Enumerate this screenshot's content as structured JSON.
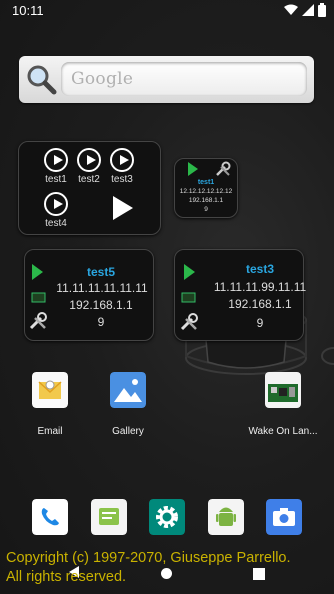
{
  "status_bar": {
    "time": "10:11"
  },
  "search": {
    "label": "Google"
  },
  "play_widget": {
    "items": [
      {
        "label": "test1"
      },
      {
        "label": "test2"
      },
      {
        "label": "test3"
      },
      {
        "label": "test4"
      }
    ]
  },
  "small_host_widget": {
    "title": "test1",
    "lines": [
      "12.12.12.12.12.12",
      "192.168.1.1",
      "9"
    ]
  },
  "host_widget_1": {
    "title": "test5",
    "lines": [
      "11.11.11.11.11.11",
      "192.168.1.1",
      "9"
    ]
  },
  "host_widget_2": {
    "title": "test3",
    "lines": [
      "11.11.11.99.11.11",
      "192.168.1.1",
      "9"
    ]
  },
  "apps": [
    {
      "label": "Email"
    },
    {
      "label": "Gallery"
    },
    {
      "label": "Wake On Lan..."
    }
  ],
  "footer": {
    "line1": "Copyright (c) 1997-2070, Giuseppe Parrello.",
    "line2": "All rights reserved."
  },
  "colors": {
    "accent_blue": "#2aa6e0",
    "play_green": "#2bb84a",
    "copyright_yellow": "#c9b200"
  }
}
